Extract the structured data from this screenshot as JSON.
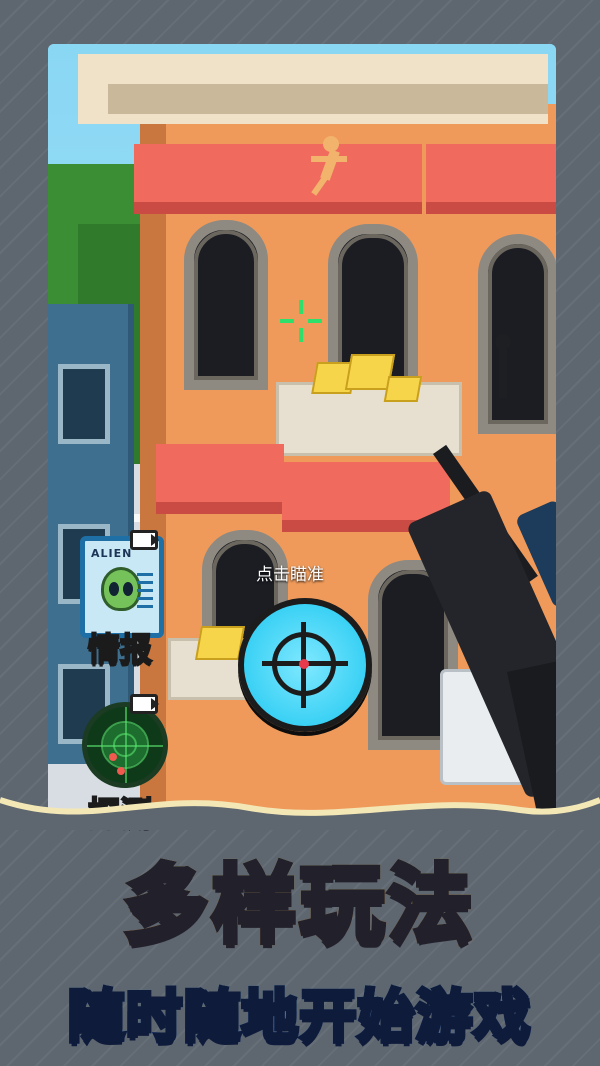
{
  "game": {
    "hint_text": "点击瞄准",
    "side_buttons": [
      {
        "label": "情报",
        "icon": "alien-file-icon",
        "card_title": "ALIEN"
      },
      {
        "label": "探测",
        "icon": "radar-icon"
      }
    ],
    "aim_button_icon": "crosshair-icon"
  },
  "promo": {
    "headline": "多样玩法",
    "subline": "随时随地开始游戏"
  },
  "colors": {
    "frame": "#5e6670",
    "building": "#ef9a5a",
    "awning": "#f06b5d",
    "aim_button": "#1dc7f0",
    "crosshair": "#2ee06b",
    "headline": "#ffb830",
    "subline": "#2563eb"
  }
}
